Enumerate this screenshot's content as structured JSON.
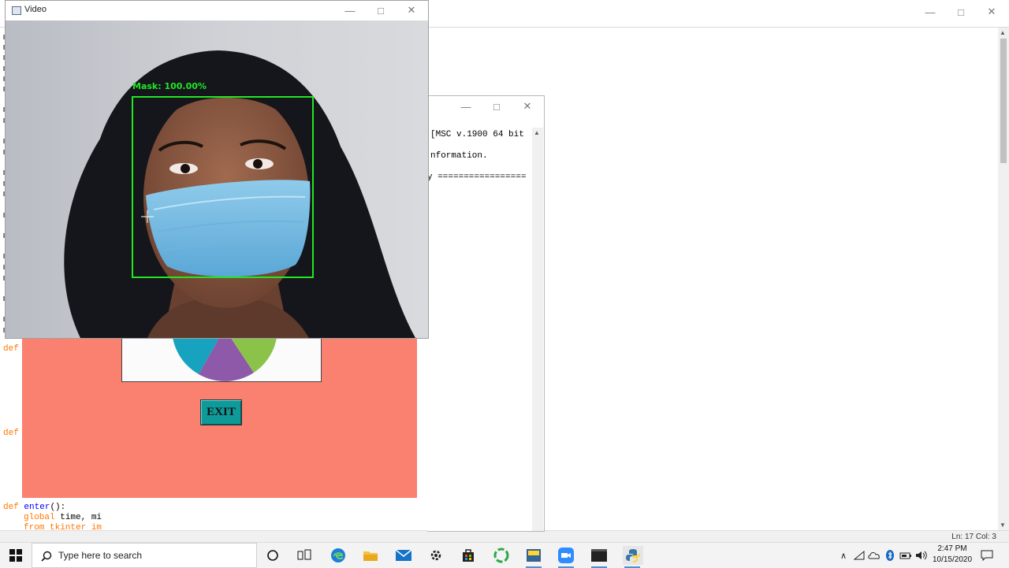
{
  "editor": {
    "line_col": "Ln: 17   Col: 3",
    "fragments": [
      {
        "text": "def"
      },
      {
        "text": "def"
      }
    ],
    "enter_def": {
      "kw": "def",
      "name": "enter",
      "rest": "():"
    },
    "global_line": {
      "kw": "global",
      "rest": " time, mi"
    },
    "cut_line": "from tkinter im",
    "left_margin_chars": [
      "i",
      "i",
      "i",
      "i",
      "i",
      "i",
      "i",
      "i",
      "i",
      "i",
      "i",
      "i",
      "i",
      "i",
      "i",
      "i",
      "i",
      "i",
      "i",
      "i",
      "i",
      "i",
      "i",
      "i",
      "i",
      "i",
      "i",
      "i",
      "i",
      "i"
    ]
  },
  "shell": {
    "lines": [
      "[MSC v.1900 64 bit",
      "",
      "nformation.",
      "",
      "y ================="
    ]
  },
  "tkapp": {
    "exit_label": "EXIT",
    "pie_colors": [
      "#17a2c0",
      "#8e59a8",
      "#8bc34a"
    ]
  },
  "video": {
    "title": "Video",
    "label": "Mask: 100.00%",
    "box_color": "#22e622"
  },
  "taskbar": {
    "search_placeholder": "Type here to search",
    "time": "2:47 PM",
    "date": "10/15/2020"
  }
}
